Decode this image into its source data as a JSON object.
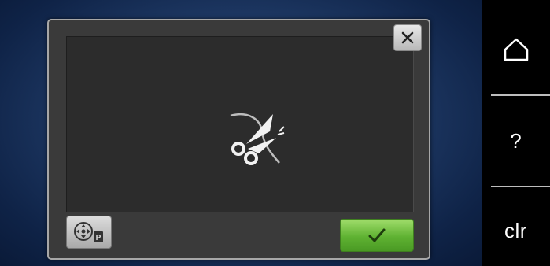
{
  "dialog": {
    "close_icon": "close-icon",
    "main_icon": "thread-cutter-scissors-icon",
    "bottom_left_icon": "move-frame-position-icon",
    "bottom_left_badge": "P",
    "confirm_icon": "checkmark-icon"
  },
  "sidebar": {
    "home_icon": "home-icon",
    "help_label": "?",
    "clr_label": "clr"
  },
  "colors": {
    "confirm_green": "#5fb232",
    "background_blue": "#1f3a66",
    "dialog_gray": "#3a3a3a"
  }
}
